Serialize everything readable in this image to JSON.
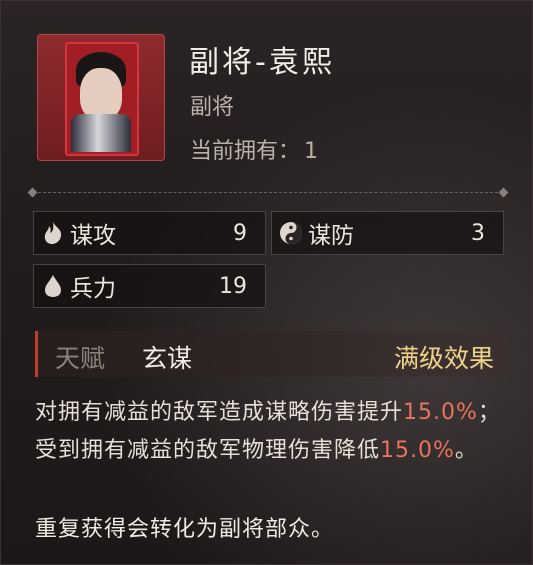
{
  "card": {
    "title": "副将-袁熙",
    "subtitle": "副将",
    "owned_label": "当前拥有：",
    "owned_count": "1"
  },
  "stats": [
    {
      "label": "谋攻",
      "value": "9",
      "icon": "flame-icon"
    },
    {
      "label": "谋防",
      "value": "3",
      "icon": "yin-yang-icon"
    },
    {
      "label": "兵力",
      "value": "19",
      "icon": "droplet-icon"
    }
  ],
  "talent": {
    "tag": "天赋",
    "name": "玄谋",
    "level": "满级效果"
  },
  "description": {
    "part1": "对拥有减益的敌军造成谋略伤害提升",
    "pct1": "15.0%",
    "part2": "；受到拥有减益的敌军物理伤害降低",
    "pct2": "15.0%",
    "part3": "。"
  },
  "footer": "重复获得会转化为副将部众。",
  "colors": {
    "highlight": "#e8735e",
    "level_gold": "#efd28a",
    "accent_red": "#c23a2f"
  }
}
